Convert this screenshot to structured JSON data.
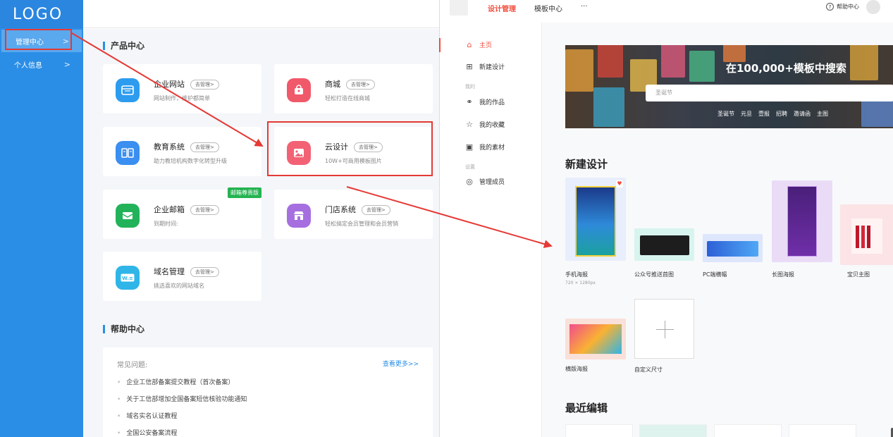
{
  "admin": {
    "logo": "LOGO",
    "sidebar": [
      {
        "label": "管理中心",
        "chevron": ">"
      },
      {
        "label": "个人信息",
        "chevron": ">"
      }
    ],
    "product_section_title": "产品中心",
    "manage_label": "去管理>",
    "products": [
      {
        "title": "企业网站",
        "subtitle": "网站制作，维护都简单"
      },
      {
        "title": "商城",
        "subtitle": "轻松打造在线商城"
      },
      {
        "title": "教育系统",
        "subtitle": "助力教培机构数字化转型升级"
      },
      {
        "title": "云设计",
        "subtitle": "10W+可商用模板图片"
      },
      {
        "title": "企业邮箱",
        "subtitle": "到期时间:",
        "badge": "邮箱尊贵版"
      },
      {
        "title": "门店系统",
        "subtitle": "轻松搞定会员管理和会员营销"
      },
      {
        "title": "域名管理",
        "subtitle": "挑选喜欢的网站域名"
      }
    ],
    "help_section_title": "帮助中心",
    "help": {
      "label": "常见问题:",
      "more": "查看更多>>",
      "items": [
        "企业工信部备案提交教程（首次备案）",
        "关于工信部增加全国备案短信核验功能通知",
        "域名实名认证教程",
        "全国公安备案流程"
      ]
    }
  },
  "design_app": {
    "nav": [
      "设计管理",
      "模板中心",
      "···"
    ],
    "help_center": "帮助中心",
    "help_glyph": "?",
    "side": {
      "home": "主页",
      "new_design": "新建设计",
      "group_mine": "我的",
      "my_works": "我的作品",
      "my_favorites": "我的收藏",
      "my_materials": "我的素材",
      "group_settings": "设置",
      "manage_members": "管理成员"
    },
    "hero": {
      "title": "在100,000+模板中搜索",
      "search_placeholder": "圣诞节",
      "tags": [
        "圣诞节",
        "元旦",
        "壹报",
        "招聘",
        "邀请函",
        "主图"
      ]
    },
    "new_design_title": "新建设计",
    "templates": [
      {
        "name": "手机海报",
        "size": "720 × 1280px"
      },
      {
        "name": "公众号推送首图"
      },
      {
        "name": "PC端横幅"
      },
      {
        "name": "长图海报"
      },
      {
        "name": "宝贝主图"
      },
      {
        "name": "横版海报"
      },
      {
        "name": "自定义尺寸"
      }
    ],
    "recent_title": "最近编辑"
  },
  "colors": {
    "sidebar_blue": "#2b8ee6",
    "accent_red": "#f24c3d",
    "annotation_red": "#e53935",
    "vip_green": "#25b352"
  },
  "icons": {
    "website": "browser-window-icon",
    "mall": "shopping-bag-icon",
    "education": "open-book-icon",
    "cloud_design": "image-icon",
    "mail": "envelope-icon",
    "store": "storefront-icon",
    "domain": "www-icon"
  }
}
